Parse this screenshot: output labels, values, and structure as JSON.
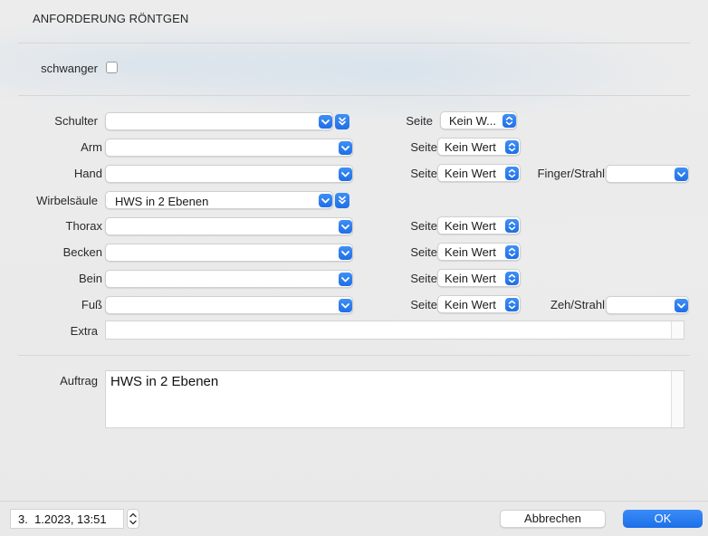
{
  "dialog": {
    "title": "ANFORDERUNG RÖNTGEN"
  },
  "pregnant": {
    "label": "schwanger",
    "checked": false
  },
  "rows": [
    {
      "label": "Schulter",
      "value": "",
      "seite": "Kein W..."
    },
    {
      "label": "Arm",
      "value": "",
      "seite": "Kein Wert"
    },
    {
      "label": "Hand",
      "value": "",
      "seite": "Kein Wert",
      "extra_label": "Finger/Strahl",
      "extra_value": ""
    },
    {
      "label": "Wirbelsäule",
      "value": "HWS in 2 Ebenen"
    },
    {
      "label": "Thorax",
      "value": "",
      "seite": "Kein Wert"
    },
    {
      "label": "Becken",
      "value": "",
      "seite": "Kein Wert"
    },
    {
      "label": "Bein",
      "value": "",
      "seite": "Kein Wert"
    },
    {
      "label": "Fuß",
      "value": "",
      "seite": "Kein Wert",
      "extra_label": "Zeh/Strahl",
      "extra_value": ""
    }
  ],
  "seite_label": "Seite",
  "extra": {
    "label": "Extra",
    "value": ""
  },
  "auftrag": {
    "label": "Auftrag",
    "value": "HWS in 2 Ebenen"
  },
  "footer": {
    "datetime": "3.  1.2023, 13:51",
    "cancel_label": "Abbrechen",
    "ok_label": "OK"
  },
  "colors": {
    "accent": "#2677ee"
  },
  "icons": {
    "select_arrow": "chevron-down-icon",
    "double_arrow": "double-chevron-down-icon",
    "seite_arrows": "up-down-chevron-icon"
  }
}
